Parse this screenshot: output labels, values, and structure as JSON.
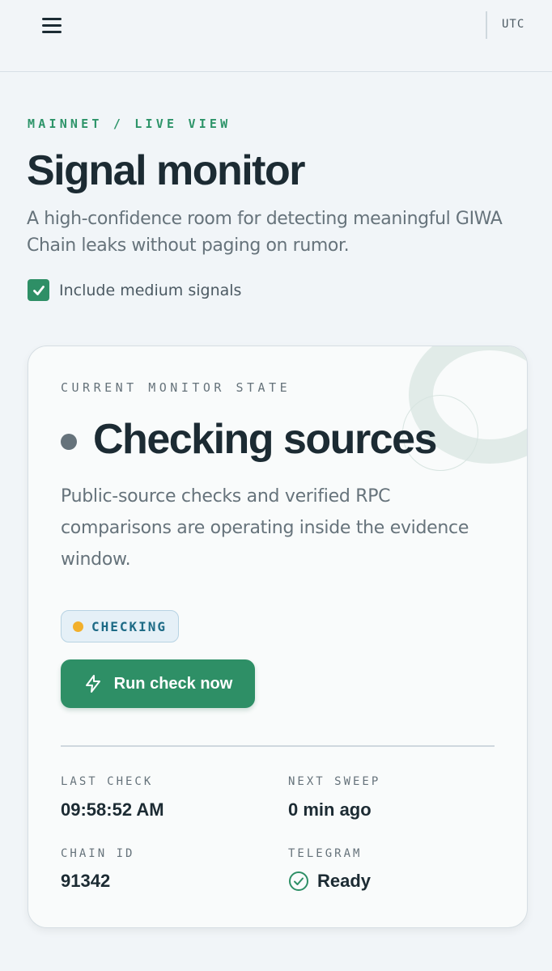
{
  "header": {
    "menu_icon": "hamburger-menu-icon",
    "timezone": "UTC"
  },
  "page": {
    "eyebrow": "MAINNET / LIVE VIEW",
    "title": "Signal monitor",
    "subtitle": "A high-confidence room for detecting meaningful GIWA Chain leaks without paging on rumor."
  },
  "filters": {
    "include_medium_label": "Include medium signals",
    "include_medium_checked": true
  },
  "monitor": {
    "eyebrow": "CURRENT MONITOR STATE",
    "state_title": "Checking sources",
    "description": "Public-source checks and verified RPC comparisons are operating inside the evidence window.",
    "badge": "CHECKING",
    "run_button_label": "Run check now",
    "meta": {
      "last_check_label": "LAST CHECK",
      "last_check_value": "09:58:52 AM",
      "next_sweep_label": "NEXT SWEEP",
      "next_sweep_value": "0 min ago",
      "chain_id_label": "CHAIN ID",
      "chain_id_value": "91342",
      "telegram_label": "TELEGRAM",
      "telegram_value": "Ready"
    }
  },
  "colors": {
    "accent": "#2e8f66",
    "badge_dot": "#f2b02c",
    "background": "#f1f5f8"
  }
}
